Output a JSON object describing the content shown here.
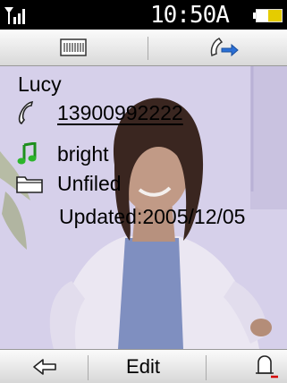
{
  "status_bar": {
    "time": "10:50A",
    "signal_icon": "signal-bars-icon",
    "battery_icon": "battery-icon",
    "battery_color": "#e5cc00"
  },
  "toolbar": {
    "left_icon": "memory-card-icon",
    "right_icon": "forward-call-icon"
  },
  "contact": {
    "name": "Lucy",
    "phone": "13900992222",
    "ringtone": "bright",
    "group": "Unfiled",
    "updated": "Updated:2005/12/05"
  },
  "softkeys": {
    "back_icon": "back-arrow-icon",
    "center_label": "Edit",
    "right_icon": "bell-icon"
  }
}
